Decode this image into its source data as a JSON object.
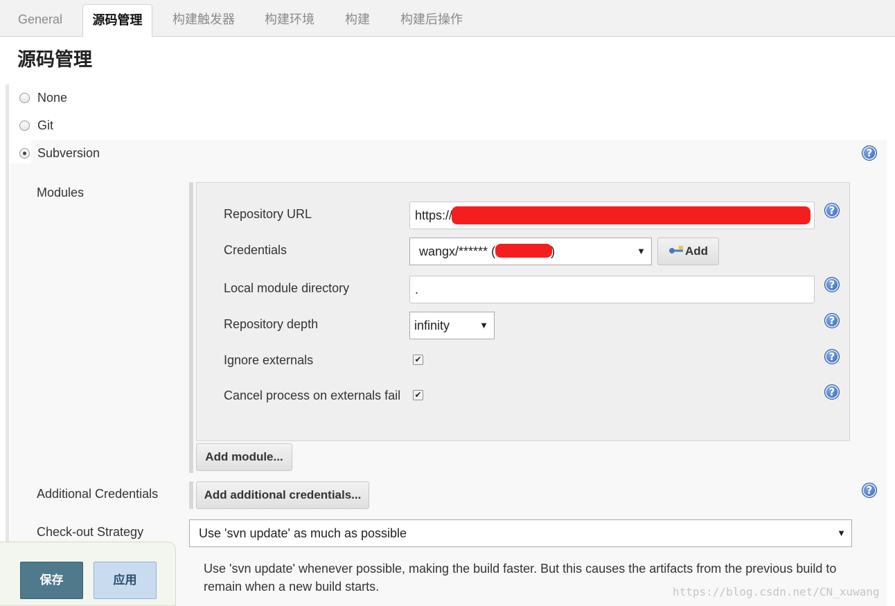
{
  "tabs": [
    {
      "label": "General",
      "active": false
    },
    {
      "label": "源码管理",
      "active": true
    },
    {
      "label": "构建触发器",
      "active": false
    },
    {
      "label": "构建环境",
      "active": false
    },
    {
      "label": "构建",
      "active": false
    },
    {
      "label": "构建后操作",
      "active": false
    }
  ],
  "section_title": "源码管理",
  "scm_options": [
    {
      "label": "None",
      "checked": false
    },
    {
      "label": "Git",
      "checked": false
    },
    {
      "label": "Subversion",
      "checked": true
    }
  ],
  "modules": {
    "label": "Modules",
    "repository_url": {
      "label": "Repository URL",
      "value": "https://"
    },
    "credentials": {
      "label": "Credentials",
      "value_prefix": "wangx/****** (",
      "value_suffix": "2)",
      "add_button": "Add"
    },
    "local_module_directory": {
      "label": "Local module directory",
      "value": "."
    },
    "repository_depth": {
      "label": "Repository depth",
      "value": "infinity"
    },
    "ignore_externals": {
      "label": "Ignore externals",
      "checked": true
    },
    "cancel_process": {
      "label": "Cancel process on externals fail",
      "checked": true
    },
    "add_module_button": "Add module..."
  },
  "additional_credentials": {
    "label": "Additional Credentials",
    "button": "Add additional credentials..."
  },
  "checkout_strategy": {
    "label": "Check-out Strategy",
    "value": "Use 'svn update' as much as possible",
    "description": "Use 'svn update' whenever possible, making the build faster. But this causes the artifacts from the previous build to remain when a new build starts."
  },
  "footer": {
    "save": "保存",
    "apply": "应用"
  },
  "watermark": "https://blog.csdn.net/CN_xuwang",
  "colors": {
    "help_icon": "#2c5fae",
    "save_button": "#4e7a8c",
    "apply_button": "#c9dcef",
    "redaction": "#f41e1e"
  }
}
